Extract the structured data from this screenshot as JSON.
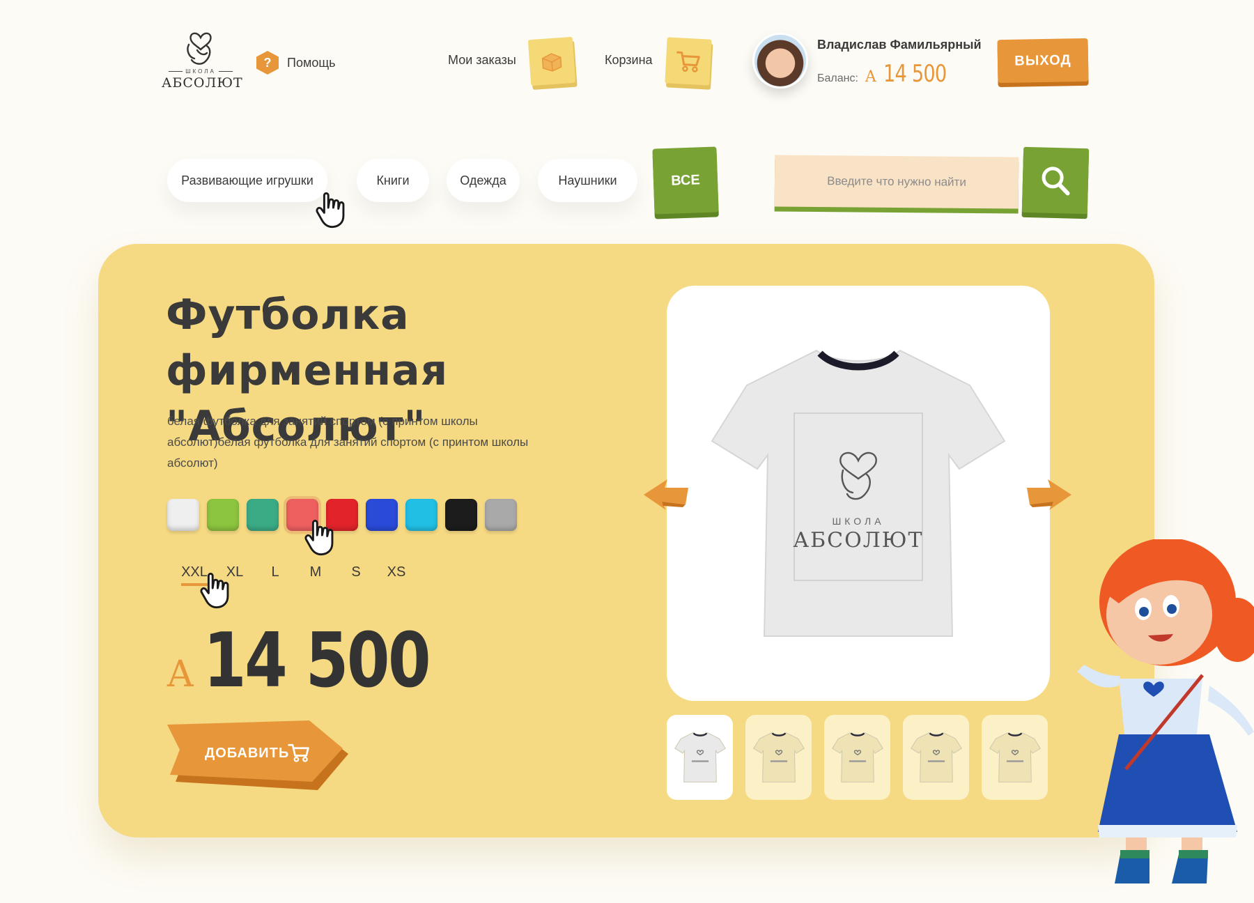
{
  "header": {
    "logo": {
      "small_text": "ШКОЛА",
      "main_text": "АБСОЛЮТ"
    },
    "help_label": "Помощь",
    "orders_label": "Мои заказы",
    "cart_label": "Корзина",
    "user": {
      "name": "Владислав Фамильярный",
      "balance_label": "Баланс:",
      "balance_currency": "A",
      "balance_value": "14 500"
    },
    "logout_label": "ВЫХОД"
  },
  "categories": {
    "items": [
      "Развивающие игрушки",
      "Книги",
      "Одежда",
      "Наушники"
    ],
    "all_label": "ВСЕ"
  },
  "search": {
    "placeholder": "Введите что нужно найти"
  },
  "product": {
    "title": "Футболка фирменная \"Абсолют\"",
    "description": "белая футболка для занятий спортом (с принтом школы абсолют)белая футболка для занятий спортом (с принтом школы абсолют)",
    "colors": [
      "#efefef",
      "#8cc53f",
      "#3bab86",
      "#ee6060",
      "#e2232a",
      "#2a4bd8",
      "#21bfe4",
      "#1c1c1c",
      "#a9a9a9"
    ],
    "selected_color_index": 3,
    "sizes": [
      "XXL",
      "XL",
      "L",
      "M",
      "S",
      "XS"
    ],
    "selected_size": "XXL",
    "price_currency": "A",
    "price_value": "14 500",
    "add_label": "ДОБАВИТЬ",
    "image_logo_small": "ШКОЛА",
    "image_logo_main": "АБСОЛЮТ",
    "thumbnail_count": 5,
    "active_thumbnail_index": 0
  },
  "colors": {
    "accent_orange": "#e8963a",
    "accent_green": "#78a334",
    "card_yellow": "#f5d983",
    "page_bg": "#fdfbf5"
  }
}
